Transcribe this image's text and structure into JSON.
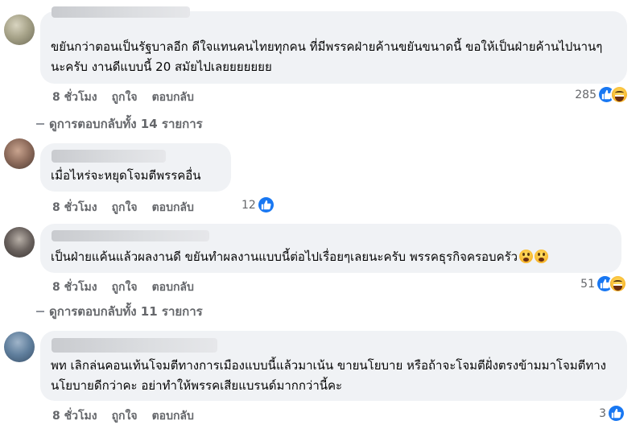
{
  "comments": [
    {
      "text": "ขยันกว่าตอนเป็นรัฐบาลอีก ดีใจแทนคนไทยทุกคน ที่มีพรรคฝ่ายค้านขยันขนาดนี้ ขอให้เป็นฝ่ายค้านไปนานๆนะครับ งานดีแบบนี้ 20 สมัยไปเลยยยยยยย",
      "time": "8 ชั่วโมง",
      "like_label": "ถูกใจ",
      "reply_label": "ตอบกลับ",
      "reactions_count": "285",
      "reaction_icons": [
        "like-icon",
        "haha-icon"
      ]
    },
    {
      "text": "เมื่อไหร่จะหยุดโจมตีพรรคอื่น",
      "time": "8 ชั่วโมง",
      "like_label": "ถูกใจ",
      "reply_label": "ตอบกลับ",
      "reactions_count": "12",
      "reaction_icons": [
        "like-icon"
      ]
    },
    {
      "text": "เป็นฝ่ายแค้นแล้วผลงานดี ขยันทำผลงานแบบนี้ต่อไปเรื่อยๆเลยนะครับ พรรคธุรกิจครอบครัว",
      "inline_emoji": [
        "astonished-emoji",
        "astonished-emoji"
      ],
      "time": "8 ชั่วโมง",
      "like_label": "ถูกใจ",
      "reply_label": "ตอบกลับ",
      "reactions_count": "51",
      "reaction_icons": [
        "like-icon",
        "haha-icon"
      ]
    },
    {
      "text": "พท เลิกล่นคอนเท้นโจมตีทางการเมืองแบบนี้แล้วมาเน้น ขายนโยบาย หรือถ้าจะโจมตีฝั่งตรงข้ามมาโจมตีทางนโยบายดีกว่าคะ อย่าทำให้พรรคเสียแบรนด์มากกว่านี้คะ",
      "time": "8 ชั่วโมง",
      "like_label": "ถูกใจ",
      "reply_label": "ตอบกลับ",
      "reactions_count": "3",
      "reaction_icons": [
        "like-icon"
      ]
    }
  ],
  "reply_threads": [
    {
      "label": "ดูการตอบกลับทั้ง 14 รายการ"
    },
    {
      "label": "ดูการตอบกลับทั้ง 11 รายการ"
    }
  ],
  "colors": {
    "bubble": "#f0f2f5",
    "secondary_text": "#65676b",
    "like_blue": "#1877f2",
    "text": "#050505"
  }
}
